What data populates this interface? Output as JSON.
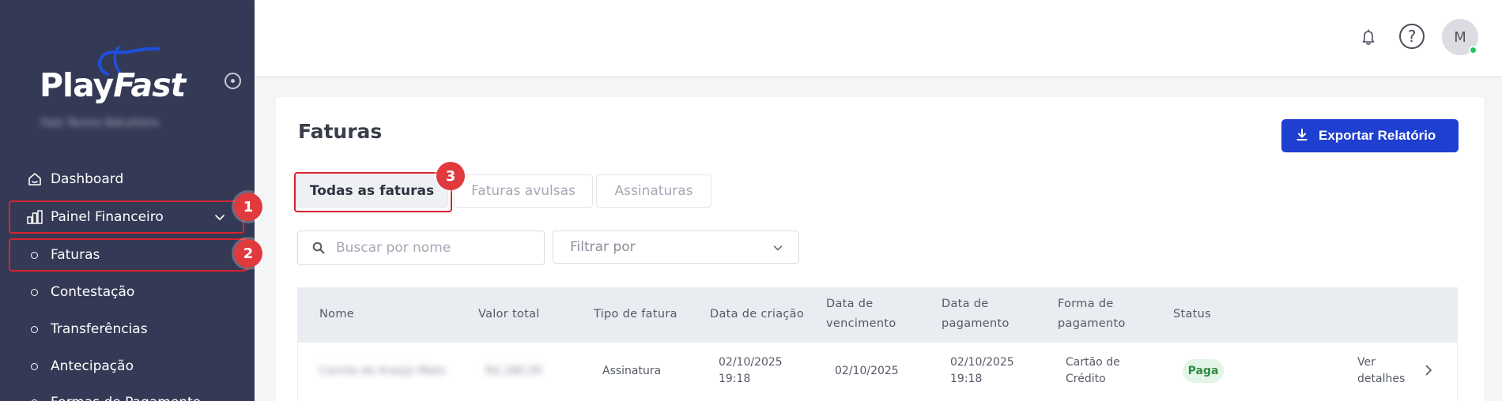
{
  "brand": {
    "part1": "Play",
    "part2": "Fast",
    "org_name": "Fast Tennis Batuiteiro"
  },
  "sidebar": {
    "items": [
      {
        "label": "Dashboard"
      },
      {
        "label": "Painel Financeiro"
      },
      {
        "label": "Faturas"
      },
      {
        "label": "Contestação"
      },
      {
        "label": "Transferências"
      },
      {
        "label": "Antecipação"
      },
      {
        "label": "Formas de Pagamento"
      }
    ]
  },
  "markers": [
    "1",
    "2",
    "3"
  ],
  "topbar": {
    "help_symbol": "?",
    "avatar_initial": "M"
  },
  "page": {
    "title": "Faturas",
    "export_label": "Exportar Relatório",
    "tabs": [
      {
        "label": "Todas as faturas",
        "active": true
      },
      {
        "label": "Faturas avulsas",
        "active": false
      },
      {
        "label": "Assinaturas",
        "active": false
      }
    ],
    "search": {
      "placeholder": "Buscar por nome",
      "value": ""
    },
    "filter": {
      "label": "Filtrar por"
    }
  },
  "table": {
    "headers": {
      "nome": "Nome",
      "valor": "Valor total",
      "tipo": "Tipo de fatura",
      "criacao": "Data de criação",
      "vencimento_1": "Data de",
      "vencimento_2": "vencimento",
      "pagamento_1": "Data de",
      "pagamento_2": "pagamento",
      "forma_1": "Forma de",
      "forma_2": "pagamento",
      "status": "Status"
    },
    "rows": [
      {
        "nome": "Camila de Araújo Matos",
        "valor": "R$ 280,00",
        "tipo": "Assinatura",
        "criacao_date": "02/10/2025",
        "criacao_time": "19:18",
        "vencimento": "02/10/2025",
        "pagamento_date": "02/10/2025",
        "pagamento_time": "19:18",
        "forma_1": "Cartão de",
        "forma_2": "Crédito",
        "status": "Paga",
        "action_1": "Ver",
        "action_2": "detalhes"
      }
    ]
  },
  "colors": {
    "sidebar_bg": "#343a55",
    "accent": "#1e3fd0",
    "highlight": "#d9232e",
    "status_paid_bg": "#e3f5e7",
    "status_paid_text": "#2f8a43"
  }
}
